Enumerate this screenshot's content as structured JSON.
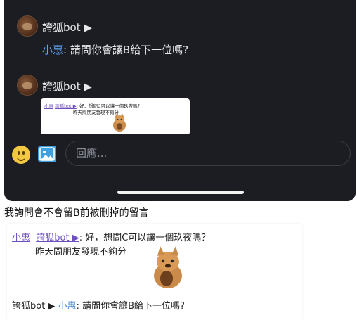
{
  "thread": {
    "messages": [
      {
        "author": "誇狐bot",
        "author_arrow": "▶",
        "mention": "小惠",
        "text": ": 請問你會讓B給下一位嗎?"
      },
      {
        "author": "誇狐bot",
        "author_arrow": "▶",
        "attachment": {
          "line1_user": "小惠",
          "line1_bot": "誇狐bot ▶",
          "line1_text": ": 好，想問C可以讓一個玖夜嗎？",
          "line2_text": "昨天問朋友發現不夠分"
        }
      }
    ]
  },
  "composer": {
    "emoji_icon": "smile-emoji-icon",
    "image_icon": "image-icon",
    "placeholder": "回應..."
  },
  "caption": "我詢問會不會留B前被刪掉的留言",
  "log": {
    "user": "小惠",
    "bot": "誇狐bot ▶",
    "reply_text": ": 好，想問C可以讓一個玖夜嗎？",
    "reply_text2": "昨天問朋友發現不夠分",
    "bot_line_author": "誇狐bot ▶",
    "bot_line_mention": "小惠",
    "bot_line_text": ": 請問你會讓B給下一位嗎?"
  },
  "colors": {
    "dark_bg": "#1b1d23",
    "mention_blue": "#5ea3f2",
    "link_purple": "#6d4fbf"
  }
}
